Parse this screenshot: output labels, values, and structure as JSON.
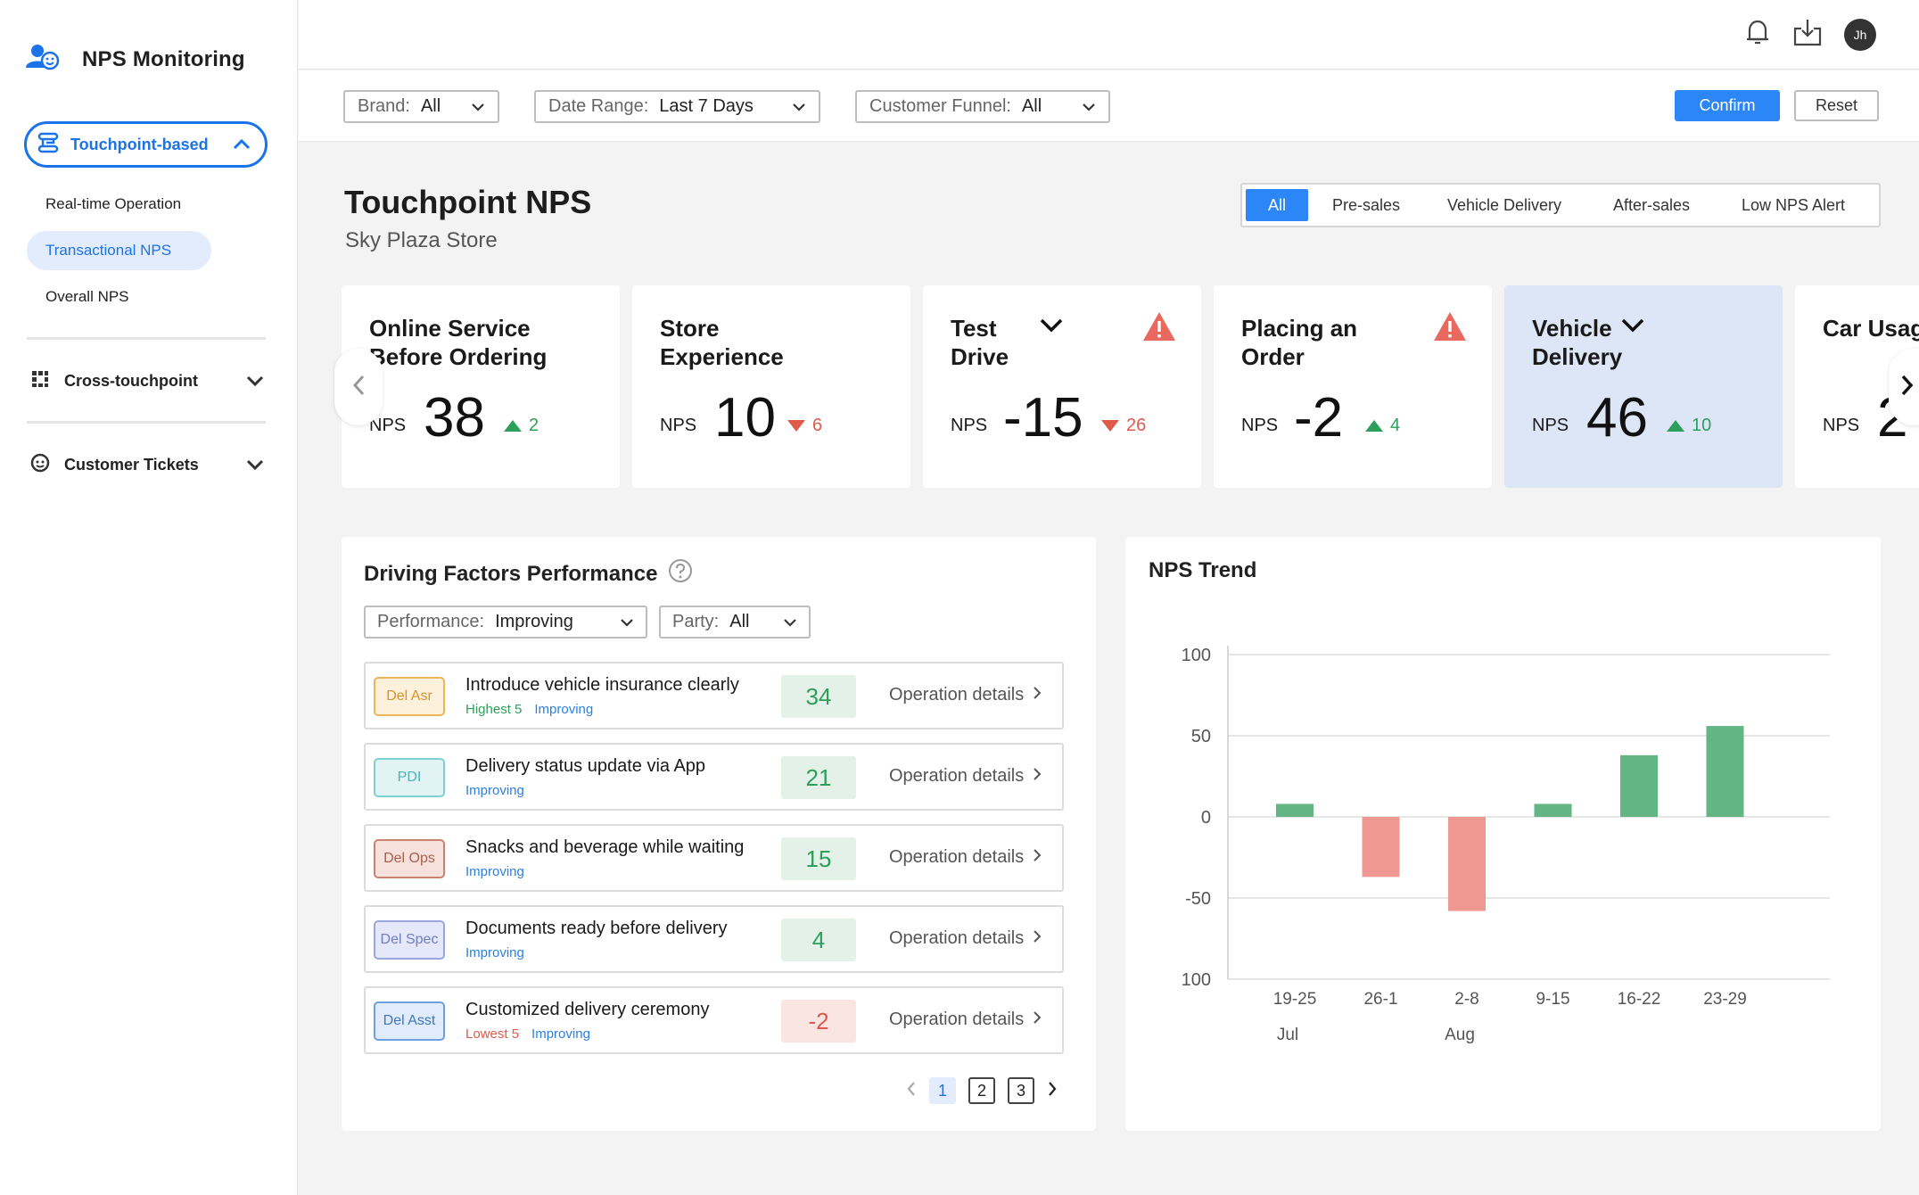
{
  "app": {
    "title": "NPS Monitoring",
    "avatar_initials": "Jh"
  },
  "sidebar": {
    "main_menu": {
      "label": "Touchpoint-based",
      "icon": "flow-icon",
      "expanded": true
    },
    "sub_items": [
      {
        "label": "Real-time Operation",
        "active": false
      },
      {
        "label": "Transactional NPS",
        "active": true
      },
      {
        "label": "Overall NPS",
        "active": false
      }
    ],
    "groups": [
      {
        "label": "Cross-touchpoint",
        "icon": "grid-dots-icon"
      },
      {
        "label": "Customer Tickets",
        "icon": "support-face-icon"
      }
    ]
  },
  "filters": {
    "brand": {
      "key": "Brand:",
      "value": "All"
    },
    "date_range": {
      "key": "Date Range:",
      "value": "Last 7 Days"
    },
    "funnel": {
      "key": "Customer Funnel:",
      "value": "All"
    },
    "confirm": "Confirm",
    "reset": "Reset"
  },
  "page": {
    "title": "Touchpoint NPS",
    "subtitle": "Sky Plaza Store",
    "segments": [
      "All",
      "Pre-sales",
      "Vehicle Delivery",
      "After-sales",
      "Low NPS Alert"
    ],
    "active_segment": "All"
  },
  "kpi_cards": [
    {
      "line1": "Online Service",
      "line2": "Before Ordering",
      "nps_label": "NPS",
      "value": "38",
      "delta": "2",
      "trend": "up",
      "alert": false,
      "dropdown": false,
      "selected": false
    },
    {
      "line1": "Store",
      "line2": "Experience",
      "nps_label": "NPS",
      "value": "10",
      "delta": "6",
      "trend": "down",
      "alert": false,
      "dropdown": false,
      "selected": false
    },
    {
      "line1": "Test",
      "line2": "Drive",
      "nps_label": "NPS",
      "value": "-15",
      "delta": "26",
      "trend": "down",
      "alert": true,
      "dropdown": true,
      "selected": false
    },
    {
      "line1": "Placing an",
      "line2": "Order",
      "nps_label": "NPS",
      "value": "-2",
      "delta": "4",
      "trend": "up",
      "alert": true,
      "dropdown": false,
      "selected": false
    },
    {
      "line1": "Vehicle",
      "line2": "Delivery",
      "nps_label": "NPS",
      "value": "46",
      "delta": "10",
      "trend": "up",
      "alert": false,
      "dropdown": true,
      "selected": true
    },
    {
      "line1": "Car Usag",
      "line2": "",
      "nps_label": "NPS",
      "value": "2",
      "delta": "",
      "trend": "",
      "alert": false,
      "dropdown": false,
      "selected": false
    }
  ],
  "driving_factors": {
    "title": "Driving Factors Performance",
    "performance_filter": {
      "key": "Performance:",
      "value": "Improving"
    },
    "party_filter": {
      "key": "Party:",
      "value": "All"
    },
    "operation_label": "Operation details",
    "rows": [
      {
        "tag": "Del Asr",
        "tag_bg": "#fdf1dc",
        "tag_border": "#e9b75a",
        "tag_color": "#d9912c",
        "title": "Introduce vehicle insurance clearly",
        "rank": "Highest 5",
        "rank_type": "hi",
        "status": "Improving",
        "score": "34",
        "score_type": "pos"
      },
      {
        "tag": "PDI",
        "tag_bg": "#e2f3f4",
        "tag_border": "#7ccfd3",
        "tag_color": "#4fb0b6",
        "title": "Delivery status update via App",
        "rank": "",
        "rank_type": "",
        "status": "Improving",
        "score": "21",
        "score_type": "pos"
      },
      {
        "tag": "Del Ops",
        "tag_bg": "#f7e1dc",
        "tag_border": "#c9836f",
        "tag_color": "#a8604c",
        "title": "Snacks and beverage while waiting",
        "rank": "",
        "rank_type": "",
        "status": "Improving",
        "score": "15",
        "score_type": "pos"
      },
      {
        "tag": "Del Spec",
        "tag_bg": "#e4e8f8",
        "tag_border": "#9aa6dc",
        "tag_color": "#6f7cc4",
        "title": "Documents ready before delivery",
        "rank": "",
        "rank_type": "",
        "status": "Improving",
        "score": "4",
        "score_type": "pos"
      },
      {
        "tag": "Del Asst",
        "tag_bg": "#e0ecfb",
        "tag_border": "#6f9fdc",
        "tag_color": "#3f76bd",
        "title": "Customized delivery ceremony",
        "rank": "Lowest 5",
        "rank_type": "lo",
        "status": "Improving",
        "score": "-2",
        "score_type": "neg"
      }
    ],
    "pagination": {
      "pages": [
        "1",
        "2",
        "3"
      ],
      "current": "1"
    }
  },
  "nps_trend": {
    "title": "NPS Trend",
    "chart_data": {
      "type": "bar",
      "categories": [
        "19-25",
        "26-1",
        "2-8",
        "9-15",
        "16-22",
        "23-29"
      ],
      "month_labels": [
        {
          "label": "Jul",
          "under": "19-25"
        },
        {
          "label": "Aug",
          "under": "2-8"
        }
      ],
      "values": [
        8,
        -37,
        -58,
        8,
        38,
        56
      ],
      "ylim": [
        -100,
        100
      ],
      "yticks": [
        100,
        50,
        0,
        -50,
        -100
      ],
      "ytick_labels": [
        "100",
        "50",
        "0",
        "-50",
        "100"
      ],
      "grid": true,
      "positive_color": "#63b584",
      "negative_color": "#ee9891"
    }
  }
}
